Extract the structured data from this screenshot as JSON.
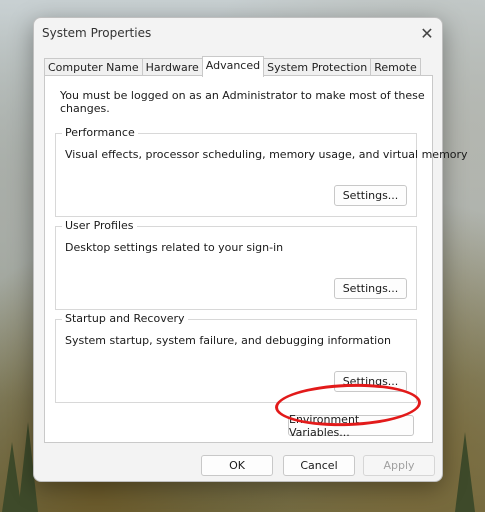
{
  "window": {
    "title": "System Properties",
    "close_glyph": "✕"
  },
  "tabs": [
    {
      "label": "Computer Name",
      "active": false
    },
    {
      "label": "Hardware",
      "active": false
    },
    {
      "label": "Advanced",
      "active": true
    },
    {
      "label": "System Protection",
      "active": false
    },
    {
      "label": "Remote",
      "active": false
    }
  ],
  "notice": "You must be logged on as an Administrator to make most of these changes.",
  "groups": {
    "performance": {
      "label": "Performance",
      "description": "Visual effects, processor scheduling, memory usage, and virtual memory",
      "button": "Settings..."
    },
    "user_profiles": {
      "label": "User Profiles",
      "description": "Desktop settings related to your sign-in",
      "button": "Settings..."
    },
    "startup_recovery": {
      "label": "Startup and Recovery",
      "description": "System startup, system failure, and debugging information",
      "button": "Settings..."
    }
  },
  "env_button": "Environment Variables...",
  "footer": {
    "ok": "OK",
    "cancel": "Cancel",
    "apply": "Apply"
  },
  "colors": {
    "highlight": "#e21a1a"
  }
}
